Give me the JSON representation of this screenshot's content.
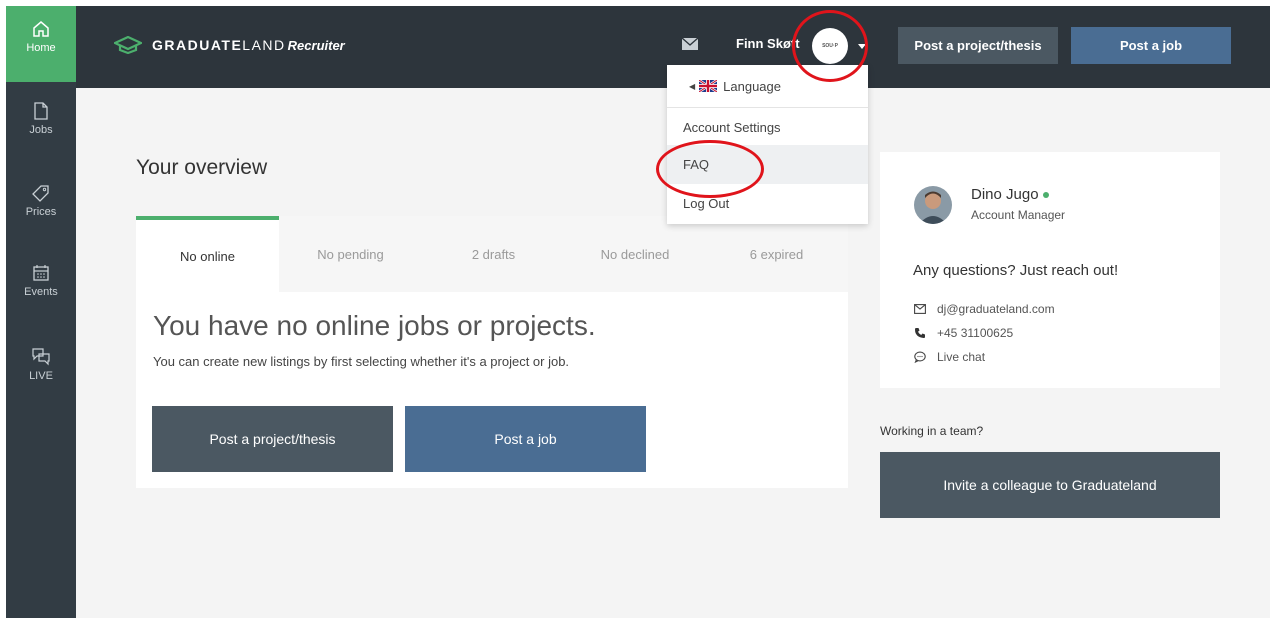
{
  "sidebar": {
    "items": [
      {
        "label": "Home",
        "icon": "home-icon"
      },
      {
        "label": "Jobs",
        "icon": "document-icon"
      },
      {
        "label": "Prices",
        "icon": "tag-icon"
      },
      {
        "label": "Events",
        "icon": "calendar-icon"
      },
      {
        "label": "LIVE",
        "icon": "chat-bubbles-icon"
      }
    ],
    "active_color": "#4caf6d"
  },
  "header": {
    "brand_bold": "GRADUATE",
    "brand_light": "LAND",
    "brand_sub": "Recruiter",
    "user_name": "Finn Skøtt",
    "avatar_text": "SOU·P",
    "post_project_label": "Post a project/thesis",
    "post_job_label": "Post a job"
  },
  "dropdown": {
    "language_label": "Language",
    "account_settings_label": "Account Settings",
    "faq_label": "FAQ",
    "logout_label": "Log Out"
  },
  "overview": {
    "title": "Your overview",
    "tabs": [
      {
        "label": "No online"
      },
      {
        "label": "No pending"
      },
      {
        "label": "2 drafts"
      },
      {
        "label": "No declined"
      },
      {
        "label": "6 expired"
      }
    ],
    "empty_title": "You have no online jobs or projects.",
    "empty_desc": "You can create new listings by first selecting whether it's a project or job.",
    "post_project_label": "Post a project/thesis",
    "post_job_label": "Post a job"
  },
  "manager": {
    "name": "Dino Jugo",
    "role": "Account Manager",
    "questions": "Any questions? Just reach out!",
    "email": "dj@graduateland.com",
    "phone": "+45 31100625",
    "chat": "Live chat"
  },
  "team": {
    "label": "Working in a team?",
    "invite_label": "Invite a colleague to Graduateland"
  },
  "colors": {
    "header_bg": "#2d353c",
    "sidebar_bg": "#323c44",
    "btn_dark": "#4b5862",
    "btn_blue": "#4a6d93",
    "accent_green": "#4caf6d",
    "annotation_red": "#e0141b"
  }
}
